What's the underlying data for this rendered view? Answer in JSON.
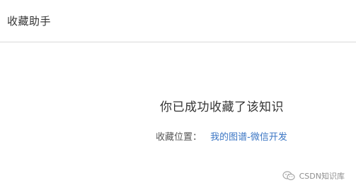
{
  "header": {
    "title": "收藏助手"
  },
  "main": {
    "success_message": "你已成功收藏了该知识",
    "location_label": "收藏位置：",
    "location_link": "我的图谱-微信开发"
  },
  "watermark": {
    "icon": "wechat-icon",
    "text": "CSDN知识库"
  },
  "colors": {
    "link": "#3b76c4",
    "divider": "#d9d9d9",
    "text": "#333333"
  }
}
